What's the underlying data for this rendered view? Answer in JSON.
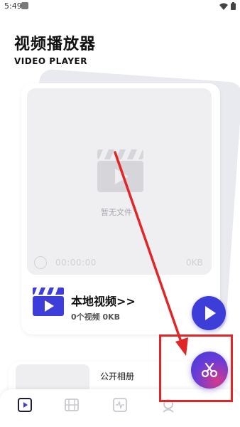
{
  "status_bar": {
    "time": "5:49"
  },
  "header": {
    "title": "视频播放器",
    "subtitle": "VIDEO PLAYER"
  },
  "preview": {
    "empty_text": "暂无文件",
    "time": "00:00:00",
    "size": "0KB"
  },
  "local_video": {
    "title": "本地视频>>",
    "count": "0个视频 0KB"
  },
  "album": {
    "title": "公开相册"
  },
  "icons": {
    "status_notification": "notification-icon",
    "wifi": "wifi-icon",
    "battery": "battery-icon",
    "clapperboard": "clapperboard-icon",
    "fab_play": "play-icon",
    "fab_cut": "scissors-icon",
    "nav": [
      "video-icon",
      "film-icon",
      "waveform-icon",
      "profile-icon"
    ]
  },
  "colors": {
    "accent": "#3d3dd9",
    "annotation": "#e02626"
  }
}
